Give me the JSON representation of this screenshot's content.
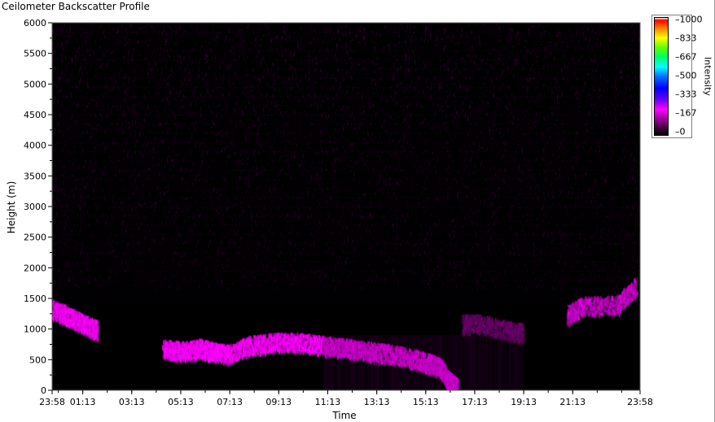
{
  "window": {
    "title": "Ceilometer Backscatter Profile"
  },
  "chart_data": {
    "type": "heatmap",
    "xlabel": "Time",
    "ylabel": "Height (m)",
    "x_ticks": [
      "23:58",
      "01:13",
      "03:13",
      "05:13",
      "07:13",
      "09:13",
      "11:13",
      "13:13",
      "15:13",
      "17:13",
      "19:13",
      "21:13",
      "23:58"
    ],
    "x_tick_hours": [
      -0.0333,
      1.2167,
      3.2167,
      5.2167,
      7.2167,
      9.2167,
      11.2167,
      13.2167,
      15.2167,
      17.2167,
      19.2167,
      21.2167,
      23.9667
    ],
    "xlim_hours": [
      -0.0333,
      23.9667
    ],
    "y_ticks": [
      0,
      500,
      1000,
      1500,
      2000,
      2500,
      3000,
      3500,
      4000,
      4500,
      5000,
      5500,
      6000
    ],
    "ylim": [
      0,
      6000
    ],
    "colorbar": {
      "title": "Intensity",
      "ticks": [
        1000,
        833,
        667,
        500,
        333,
        167,
        0
      ],
      "range": [
        0,
        1000
      ],
      "colors": [
        "#000000",
        "#a000a0",
        "#ff00ff",
        "#0000ff",
        "#00ffff",
        "#00ff00",
        "#ffff00",
        "#ff0000",
        "#ffffff"
      ]
    },
    "background_noise_intensity": 40,
    "features": [
      {
        "desc": "low layer",
        "points_hours_height": [
          [
            0.0,
            1350
          ],
          [
            0.5,
            1250
          ],
          [
            1.0,
            1150
          ],
          [
            1.5,
            1050
          ],
          [
            1.8,
            1000
          ]
        ],
        "intensity": 230
      },
      {
        "desc": "main aerosol layer",
        "points_hours_height": [
          [
            4.5,
            700
          ],
          [
            5.2,
            650
          ],
          [
            6.0,
            700
          ],
          [
            6.5,
            650
          ],
          [
            7.2,
            600
          ],
          [
            8.0,
            750
          ],
          [
            9.0,
            800
          ],
          [
            10.0,
            800
          ],
          [
            11.0,
            750
          ],
          [
            12.0,
            700
          ],
          [
            13.0,
            650
          ],
          [
            14.0,
            600
          ],
          [
            15.0,
            500
          ],
          [
            15.8,
            400
          ],
          [
            16.2,
            150
          ],
          [
            16.5,
            50
          ]
        ],
        "intensity": 260
      },
      {
        "desc": "afternoon residual",
        "points_hours_height": [
          [
            16.7,
            1100
          ],
          [
            17.5,
            1100
          ],
          [
            18.5,
            1000
          ],
          [
            19.2,
            950
          ]
        ],
        "intensity": 90
      },
      {
        "desc": "evening plumes",
        "points_hours_height": [
          [
            21.0,
            1250
          ],
          [
            21.7,
            1400
          ],
          [
            23.0,
            1400
          ],
          [
            23.8,
            1700
          ]
        ],
        "intensity": 170
      }
    ]
  }
}
